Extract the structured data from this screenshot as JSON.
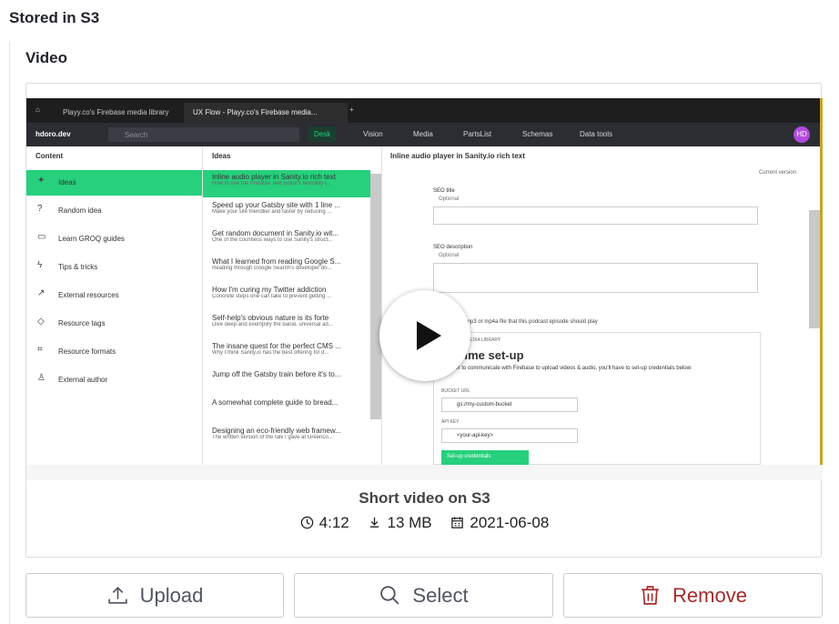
{
  "section": {
    "title": "Stored in S3"
  },
  "field": {
    "label": "Video"
  },
  "video": {
    "title": "Short video on S3",
    "duration": "4:12",
    "size": "13 MB",
    "date": "2021-06-08",
    "screenshot": {
      "tabs": [
        "Playy.co's Firebase media library",
        "UX Flow - Playy.co's Firebase media..."
      ],
      "workspace": "hdoro.dev",
      "search_placeholder": "Search",
      "nav": [
        "Desk",
        "Vision",
        "Media",
        "PartsList",
        "Schemas",
        "Data tools"
      ],
      "avatar": "HD",
      "content_header": "Content",
      "content_items": [
        "Ideas",
        "Random idea",
        "Learn GROQ guides",
        "Tips & tricks",
        "External resources",
        "Resource tags",
        "Resource formats",
        "External author"
      ],
      "ideas_header": "Ideas",
      "ideas": [
        {
          "title": "Inline audio player in Sanity.io rich text",
          "sub": "How to use the Portable Text Editor's flexibility t..."
        },
        {
          "title": "Speed up your Gatsby site with 1 line ...",
          "sub": "Make your site friendlier and faster by reducing ..."
        },
        {
          "title": "Get random document in Sanity.io wit...",
          "sub": "One of the countless ways to use Sanity's struct..."
        },
        {
          "title": "What I learned from reading Google S...",
          "sub": "Reading through Google Search's developer do..."
        },
        {
          "title": "How I'm curing my Twitter addiction",
          "sub": "Concrete steps one can take to prevent getting ..."
        },
        {
          "title": "Self-help's obvious nature is its forte",
          "sub": "Dive deep and exemplify the banal, universal ad..."
        },
        {
          "title": "The insane quest for the perfect CMS ...",
          "sub": "Why I think Sanity.io has the best offering for d..."
        },
        {
          "title": "Jump off the Gatsby train before it's to...",
          "sub": ""
        },
        {
          "title": "A somewhat complete guide to bread...",
          "sub": ""
        },
        {
          "title": "Designing an eco-friendly web framew...",
          "sub": "The written version of the talk I gave at Greenco..."
        }
      ],
      "doc_title": "Inline audio player in Sanity.io rich text",
      "version": "Current version",
      "seo_title": "SEO title",
      "seo_desc": "SEO description",
      "optional": "Optional",
      "audio_hint": "mp3 or mp4a file that this podcast episode should play",
      "media_lib": "MEDIA LIBRARY",
      "setup_title": "st time set-up",
      "setup_text": "In order to communicate with Firebase to upload videos & audio, you'll have to set-up credentials below:",
      "bucket_label": "BUCKET URL",
      "bucket_value": "gs://my-custom-bucket",
      "api_label": "API KEY",
      "api_value": "<your-api-key>",
      "setup_button": "Set-up credentials"
    }
  },
  "buttons": {
    "upload": "Upload",
    "select": "Select",
    "remove": "Remove"
  },
  "colors": {
    "accent": "#26d07c",
    "remove": "#a52a2a",
    "frame_highlight": "#c7a524"
  }
}
